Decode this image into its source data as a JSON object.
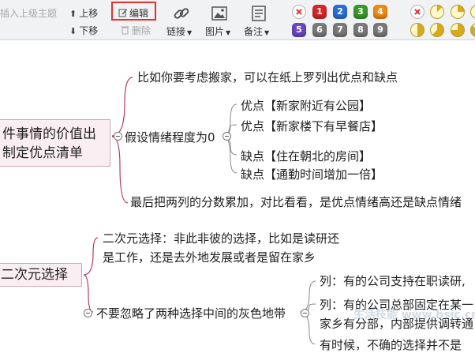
{
  "toolbar": {
    "insert_parent_label": "插入上级主题",
    "move_up_label": "上移",
    "move_down_label": "下移",
    "edit_label": "编辑",
    "delete_label": "删除",
    "link_label": "链接",
    "image_label": "图片",
    "note_label": "备注",
    "priority_badges": [
      {
        "label": "1",
        "color": "#d8252a"
      },
      {
        "label": "2",
        "color": "#2a6fd6"
      },
      {
        "label": "3",
        "color": "#3a9a2d"
      },
      {
        "label": "4",
        "color": "#f08c15"
      },
      {
        "label": "5",
        "color": "#6a48c4"
      },
      {
        "label": "6",
        "color": "#7a7a7a"
      },
      {
        "label": "7",
        "color": "#7a7a7a"
      },
      {
        "label": "8",
        "color": "#7a7a7a"
      },
      {
        "label": "9",
        "color": "#7a7a7a"
      }
    ],
    "progress_levels": [
      0,
      0.125,
      0.25,
      0.375,
      0.5,
      0.625,
      0.75,
      0.875,
      1
    ]
  },
  "mindmap": {
    "topic1": "件事情的价值出\n制定优点清单",
    "topic1_line1": "件事情的价值出",
    "topic1_line2": "制定优点清单",
    "n_move": "比如你要考虑搬家，可以在纸上罗列出优点和缺点",
    "n_assume": "假设情绪程度为0",
    "pro1": "优点【新家附近有公园】",
    "pro2": "优点【新家楼下有早餐店】",
    "con1": "缺点【住在朝北的房间】",
    "con2": "缺点【通勤时间增加一倍】",
    "n_sum": "最后把两列的分数累加，对比看看，是优点情绪高还是缺点情绪",
    "topic2": "二次元选择",
    "n_binary_1": "二次元选择：非此非彼的选择，比如是读研还",
    "n_binary_2": "是工作，还是去外地发展或者是留在家乡",
    "n_gray": "不要忽略了两种选择中间的灰色地带",
    "ex1": "列：有的公司支持在职读研,",
    "ex2_1": "列：有的公司总部固定在某一",
    "ex2_2": "家乡有分部，内部提供调转通",
    "ex3": "有时候，不确的选择并不是"
  },
  "watermark": "生活技能 www.bsjc.cn"
}
